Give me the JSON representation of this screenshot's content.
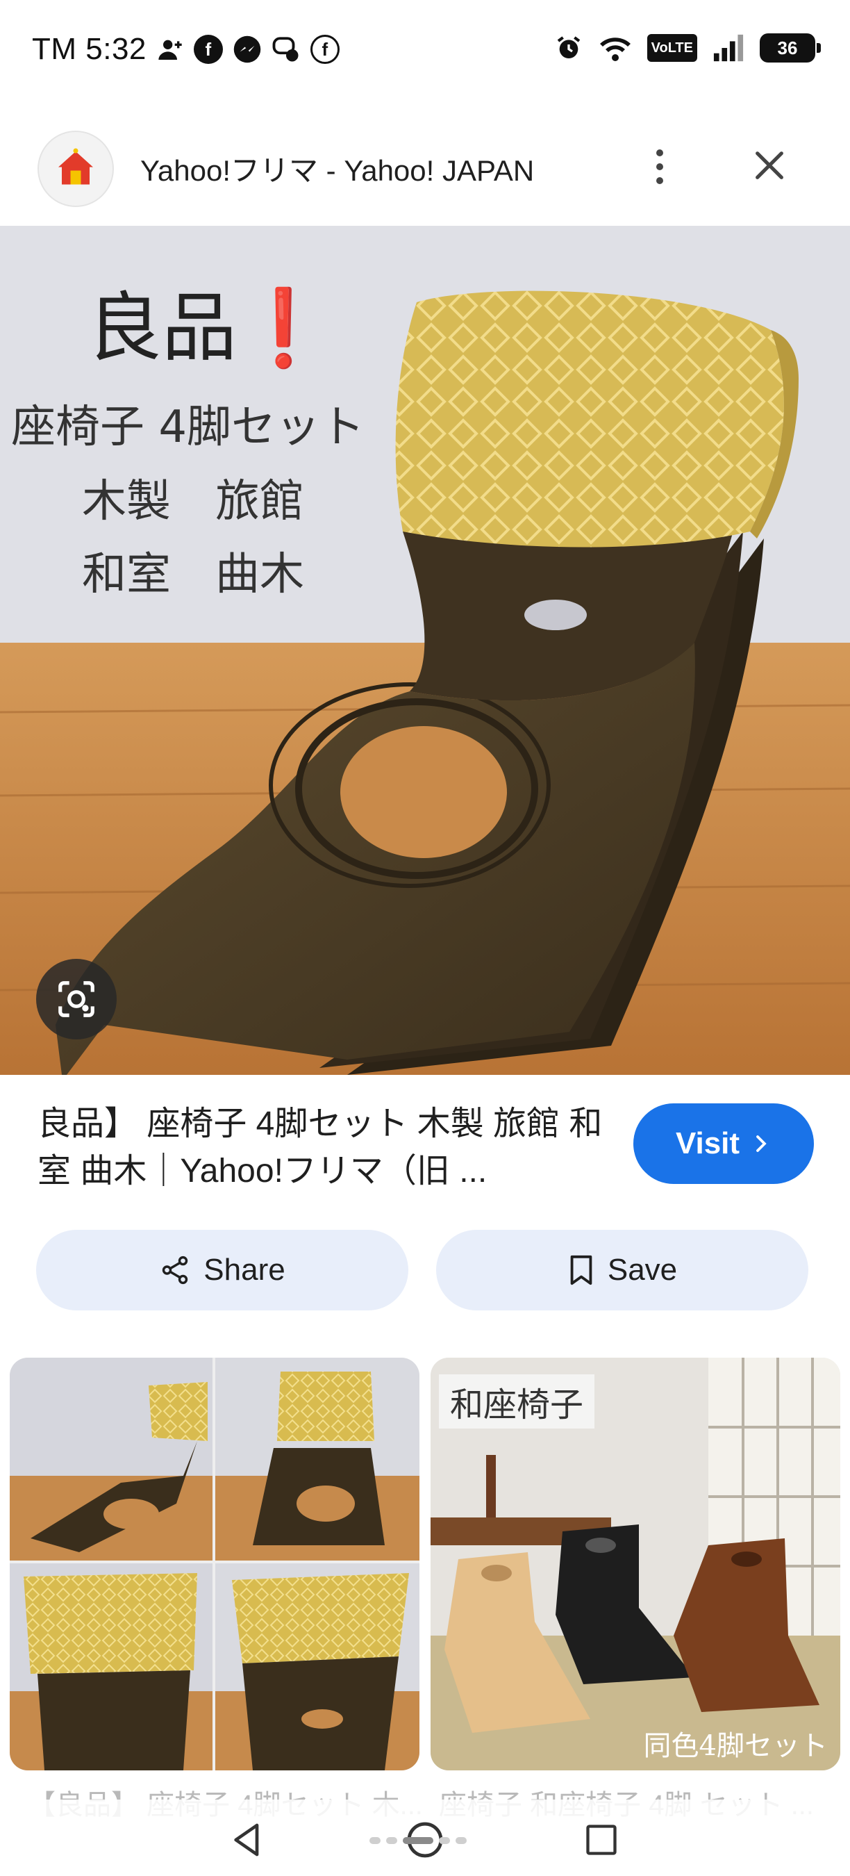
{
  "status_bar": {
    "time": "TM 5:32",
    "battery": "36",
    "volte_label": "VoLTE",
    "left_icons": [
      "person-add-icon",
      "facebook-icon",
      "messenger-icon",
      "chat-icon",
      "facebook-icon"
    ],
    "right_icons": [
      "alarm-icon",
      "wifi-icon",
      "volte-icon",
      "signal-icon",
      "battery-icon"
    ]
  },
  "header": {
    "site_title": "Yahoo!フリマ - Yahoo! JAPAN",
    "more_icon": "more-vertical-icon",
    "close_icon": "close-icon"
  },
  "main_image": {
    "overlay_text": {
      "headline": "良品",
      "exclaim": "❗",
      "line1": "座椅子 4脚セット",
      "line2": "木製　旅館",
      "line3": "和室　曲木"
    },
    "colors": {
      "wall": "#dfe0e6",
      "floor": "#c98a4a",
      "wood": "#4a3a24",
      "cushion": "#d9be5c"
    }
  },
  "result": {
    "title": "良品】 座椅子 4脚セット 木製 旅館 和室 曲木｜Yahoo!フリマ（旧 ...",
    "visit_label": "Visit",
    "share_label": "Share",
    "save_label": "Save",
    "accent_color": "#1a73e8"
  },
  "related": [
    {
      "caption": "【良品】 座椅子 4脚セット 木..."
    },
    {
      "caption": "座椅子 和座椅子 4脚 セット ...",
      "overlay_label": "和座椅子",
      "overlay_bottom": "同色4脚セット"
    }
  ]
}
